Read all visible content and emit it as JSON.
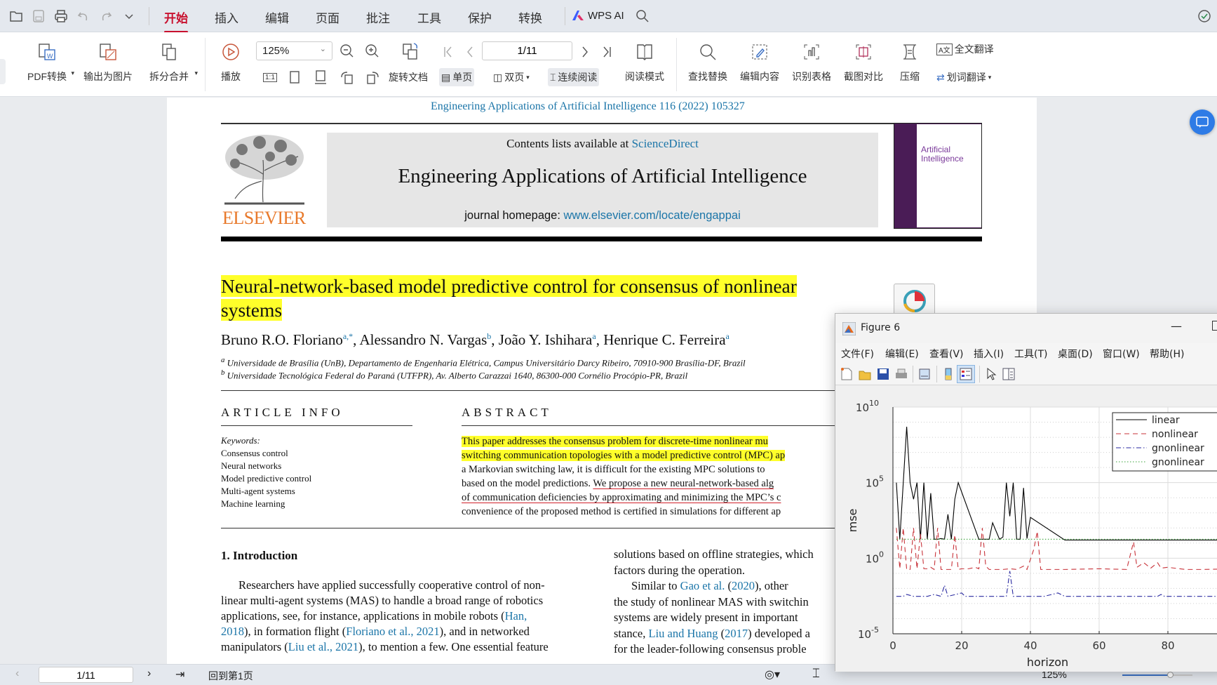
{
  "topbar": {
    "tabs": [
      "开始",
      "插入",
      "编辑",
      "页面",
      "批注",
      "工具",
      "保护",
      "转换"
    ],
    "active_tab": "开始",
    "wps_ai": "WPS AI"
  },
  "ribbon": {
    "pdf_convert": "PDF转换",
    "export_image": "输出为图片",
    "split_merge": "拆分合并",
    "play": "播放",
    "zoom": "125%",
    "page": "1/11",
    "rotate_doc": "旋转文档",
    "single_page": "单页",
    "double_page": "双页",
    "continuous": "连续阅读",
    "reading_mode": "阅读模式",
    "find_replace": "查找替换",
    "edit_content": "编辑内容",
    "recognize_table": "识别表格",
    "screenshot_compare": "截图对比",
    "compress": "压缩",
    "full_translate": "全文翻译",
    "word_translate": "划词翻译",
    "one_to_one": "1:1"
  },
  "document": {
    "running_header": "Engineering Applications of Artificial Intelligence 116 (2022) 105327",
    "publisher_logo": "ELSEVIER",
    "contents_prefix": "Contents lists available at ",
    "contents_link": "ScienceDirect",
    "journal_title": "Engineering Applications of Artificial Intelligence",
    "homepage_prefix": "journal homepage: ",
    "homepage_link": "www.elsevier.com/locate/engappai",
    "cover_text": "Artificial Intelligence",
    "title_line1": "Neural-network-based model predictive control for consensus of nonlinear",
    "title_line2": "systems",
    "authors": [
      {
        "name": "Bruno R.O. Floriano",
        "sup": "a,*"
      },
      {
        "name": "Alessandro N. Vargas",
        "sup": "b"
      },
      {
        "name": "João Y. Ishihara",
        "sup": "a"
      },
      {
        "name": "Henrique C. Ferreira",
        "sup": "a"
      }
    ],
    "affiliations": [
      {
        "sup": "a",
        "text": "Universidade de Brasília (UnB), Departamento de Engenharia Elétrica, Campus Universitário Darcy Ribeiro, 70910-900 Brasília-DF, Brazil"
      },
      {
        "sup": "b",
        "text": "Universidade Tecnológica Federal do Paraná (UTFPR), Av. Alberto Carazzai 1640, 86300-000 Cornélio Procópio-PR, Brazil"
      }
    ],
    "article_info_heading": "ARTICLE INFO",
    "abstract_heading": "ABSTRACT",
    "keywords_label": "Keywords:",
    "keywords": [
      "Consensus control",
      "Neural networks",
      "Model predictive control",
      "Multi-agent systems",
      "Machine learning"
    ],
    "abstract_lines": [
      "This paper addresses the consensus problem for discrete-time nonlinear mu",
      "switching communication topologies with a model predictive control (MPC) ap",
      "a Markovian switching law, it is difficult for the existing MPC solutions to",
      "based on the model predictions. ",
      "We propose a new neural-network-based alg",
      "of communication deficiencies by approximating and minimizing the MPC’s c",
      "convenience of the proposed method is certified in simulations for different ap"
    ],
    "intro_heading": "1. Introduction",
    "intro_left": [
      "Researchers have applied successfully cooperative control of non-",
      "linear multi-agent systems (MAS) to handle a broad range of robotics",
      "applications, see, for instance, applications in mobile robots (",
      "Han,",
      "2018",
      "), in formation flight (",
      "Floriano et al., 2021",
      "), and in networked",
      "manipulators (",
      "Liu et al., 2021",
      "), to mention a few. One essential feature"
    ],
    "intro_right": [
      "solutions based on offline strategies, which",
      "factors during the operation.",
      "Similar to ",
      "Gao et al.",
      "(",
      "2020",
      "), other",
      "the study of nonlinear MAS with switchin",
      "systems are widely present in important",
      "stance, ",
      "Liu and Huang",
      " (",
      "2017",
      ") developed a",
      "for the leader-following consensus proble"
    ]
  },
  "status": {
    "page": "1/11",
    "back_to_first": "回到第1页",
    "zoom": "125%"
  },
  "figure": {
    "title": "Figure 6",
    "menu": [
      "文件(F)",
      "编辑(E)",
      "查看(V)",
      "插入(I)",
      "工具(T)",
      "桌面(D)",
      "窗口(W)",
      "帮助(H)"
    ]
  },
  "chart_data": {
    "type": "line",
    "xlabel": "horizon",
    "ylabel": "mse",
    "xlim": [
      0,
      100
    ],
    "ylim": [
      1e-05,
      10000000000.0
    ],
    "yscale": "log",
    "grid": true,
    "legend_position": "top-right",
    "xticks": [
      0,
      20,
      40,
      60,
      80
    ],
    "yticks": [
      {
        "base": "10",
        "exp": "10"
      },
      {
        "base": "10",
        "exp": "5"
      },
      {
        "base": "10",
        "exp": "0"
      },
      {
        "base": "10",
        "exp": "-5"
      }
    ],
    "series": [
      {
        "name": "linear",
        "color": "#000000",
        "style": "solid",
        "points": [
          [
            1,
            100000.0
          ],
          [
            2,
            18
          ],
          [
            4,
            500000000.0
          ],
          [
            5,
            100000.0
          ],
          [
            6,
            8000
          ],
          [
            7,
            100000.0
          ],
          [
            8,
            18
          ],
          [
            9,
            100000.0
          ],
          [
            10,
            18
          ],
          [
            11,
            20000
          ],
          [
            12,
            18
          ],
          [
            13,
            18
          ],
          [
            14,
            20
          ],
          [
            15,
            18
          ],
          [
            16,
            800
          ],
          [
            17,
            18
          ],
          [
            18,
            8000
          ],
          [
            19,
            100000.0
          ],
          [
            25,
            18
          ],
          [
            28,
            18
          ],
          [
            29,
            220
          ],
          [
            31,
            18
          ],
          [
            32,
            25
          ],
          [
            33,
            100000.0
          ],
          [
            34,
            600
          ],
          [
            35,
            100000.0
          ],
          [
            36,
            18
          ],
          [
            37,
            18
          ],
          [
            38,
            45000
          ],
          [
            39,
            20
          ],
          [
            40,
            500
          ],
          [
            50,
            16
          ],
          [
            100,
            16
          ]
        ]
      },
      {
        "name": "nonlinear",
        "color": "#c8333a",
        "style": "dashed",
        "points": [
          [
            1,
            100
          ],
          [
            2,
            0.2
          ],
          [
            3,
            100
          ],
          [
            4,
            0.18
          ],
          [
            5,
            0.18
          ],
          [
            6,
            100
          ],
          [
            7,
            0.2
          ],
          [
            8,
            40
          ],
          [
            9,
            0.2
          ],
          [
            10,
            0.2
          ],
          [
            11,
            0.25
          ],
          [
            12,
            0.18
          ],
          [
            13,
            100
          ],
          [
            14,
            0.18
          ],
          [
            16,
            0.18
          ],
          [
            17,
            0.18
          ],
          [
            18,
            35
          ],
          [
            19,
            0.18
          ],
          [
            20,
            0.2
          ],
          [
            22,
            0.2
          ],
          [
            24,
            0.25
          ],
          [
            25,
            0.2
          ],
          [
            26,
            100
          ],
          [
            27,
            0.3
          ],
          [
            28,
            0.18
          ],
          [
            30,
            0.18
          ],
          [
            32,
            0.18
          ],
          [
            34,
            0.2
          ],
          [
            36,
            0.18
          ],
          [
            38,
            0.3
          ],
          [
            39,
            0.18
          ],
          [
            41,
            4
          ],
          [
            42,
            60
          ],
          [
            43,
            0.18
          ],
          [
            50,
            0.18
          ],
          [
            60,
            0.2
          ],
          [
            68,
            0.18
          ],
          [
            70,
            12
          ],
          [
            71,
            0.25
          ],
          [
            73,
            0.5
          ],
          [
            75,
            0.22
          ],
          [
            77,
            0.5
          ],
          [
            78,
            0.22
          ],
          [
            80,
            0.25
          ],
          [
            85,
            0.18
          ],
          [
            90,
            0.18
          ],
          [
            100,
            0.2
          ]
        ]
      },
      {
        "name": "gnonlinear",
        "color": "#2a2aa0",
        "style": "dashdot",
        "points": [
          [
            1,
            0.003
          ],
          [
            3,
            0.003
          ],
          [
            4,
            0.004
          ],
          [
            6,
            0.003
          ],
          [
            10,
            0.003
          ],
          [
            12,
            0.004
          ],
          [
            14,
            0.003
          ],
          [
            15,
            0.016
          ],
          [
            16,
            0.003
          ],
          [
            20,
            0.005
          ],
          [
            21,
            0.003
          ],
          [
            33,
            0.003
          ],
          [
            34,
            0.14
          ],
          [
            35,
            0.003
          ],
          [
            44,
            0.003
          ],
          [
            48,
            0.005
          ],
          [
            50,
            0.003
          ],
          [
            77,
            0.003
          ],
          [
            78,
            0.004
          ],
          [
            79,
            0.003
          ],
          [
            100,
            0.003
          ]
        ]
      },
      {
        "name": "gnonlinear",
        "color": "#3aa33a",
        "style": "dotted",
        "points": [
          [
            1,
            18
          ],
          [
            100,
            18
          ]
        ]
      }
    ]
  }
}
